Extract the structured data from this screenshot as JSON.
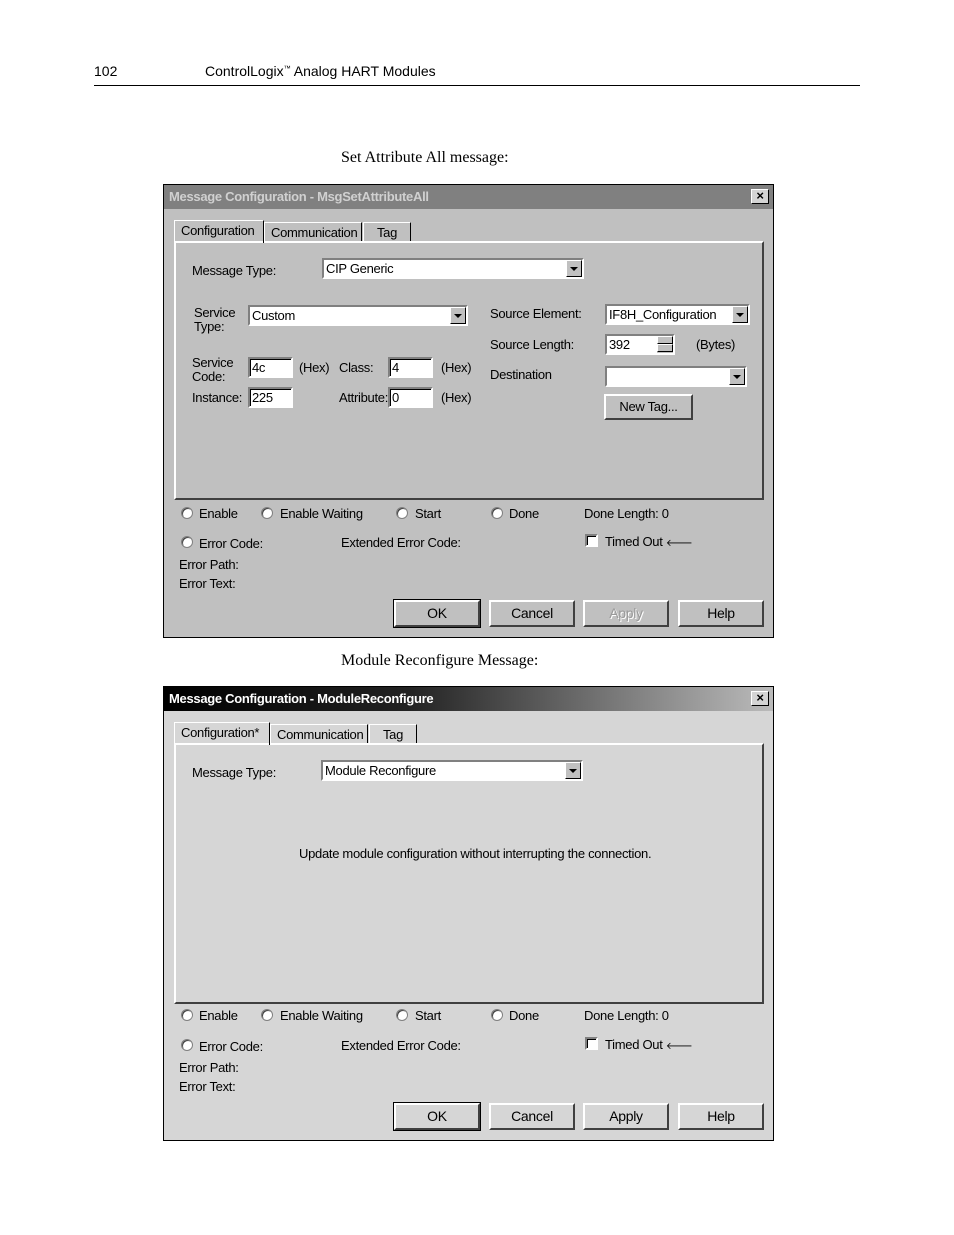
{
  "page": {
    "number": "102",
    "running_title": "ControlLogix",
    "tm": "™",
    "running_title_rest": " Analog HART Modules"
  },
  "captions": {
    "first": "Set Attribute All message:",
    "second": "Module Reconfigure Message:"
  },
  "dialog1": {
    "title": "Message Configuration - MsgSetAttributeAll",
    "close_icon": "close-x-icon",
    "tabs": [
      "Configuration",
      "Communication",
      "Tag"
    ],
    "active_tab": "Configuration",
    "message_type_label": "Message Type:",
    "message_type_value": "CIP Generic",
    "service_type_label_1": "Service",
    "service_type_label_2": "Type:",
    "service_type_value": "Custom",
    "service_code_label_1": "Service",
    "service_code_label_2": "Code:",
    "service_code_value": "4c",
    "hex": "(Hex)",
    "class_label": "Class:",
    "class_value": "4",
    "instance_label": "Instance:",
    "instance_value": "225",
    "attribute_label": "Attribute:",
    "attribute_value": "0",
    "source_element_label": "Source Element:",
    "source_element_value": "IF8H_Configuration",
    "source_length_label": "Source Length:",
    "source_length_value": "392",
    "bytes": "(Bytes)",
    "destination_label": "Destination",
    "destination_value": "",
    "new_tag_button": "New Tag...",
    "status": {
      "enable": "Enable",
      "enable_waiting": "Enable Waiting",
      "start": "Start",
      "done": "Done",
      "done_length": "Done Length:  0",
      "error_code": "Error Code:",
      "extended_error_code": "Extended Error Code:",
      "timed_out": "Timed Out",
      "timed_out_arrow": "🡐",
      "error_path": "Error Path:",
      "error_text": "Error Text:"
    },
    "buttons": {
      "ok": "OK",
      "cancel": "Cancel",
      "apply": "Apply",
      "help": "Help"
    },
    "apply_enabled": false
  },
  "dialog2": {
    "title": "Message Configuration - ModuleReconfigure",
    "tabs": [
      "Configuration*",
      "Communication",
      "Tag"
    ],
    "active_tab": "Configuration*",
    "message_type_label": "Message Type:",
    "message_type_value": "Module Reconfigure",
    "description": "Update module configuration without interrupting the connection.",
    "status": {
      "enable": "Enable",
      "enable_waiting": "Enable Waiting",
      "start": "Start",
      "done": "Done",
      "done_length": "Done Length:  0",
      "error_code": "Error Code:",
      "extended_error_code": "Extended Error Code:",
      "timed_out": "Timed Out",
      "timed_out_arrow": "🡐",
      "error_path": "Error Path:",
      "error_text": "Error Text:"
    },
    "buttons": {
      "ok": "OK",
      "cancel": "Cancel",
      "apply": "Apply",
      "help": "Help"
    },
    "apply_enabled": true
  }
}
